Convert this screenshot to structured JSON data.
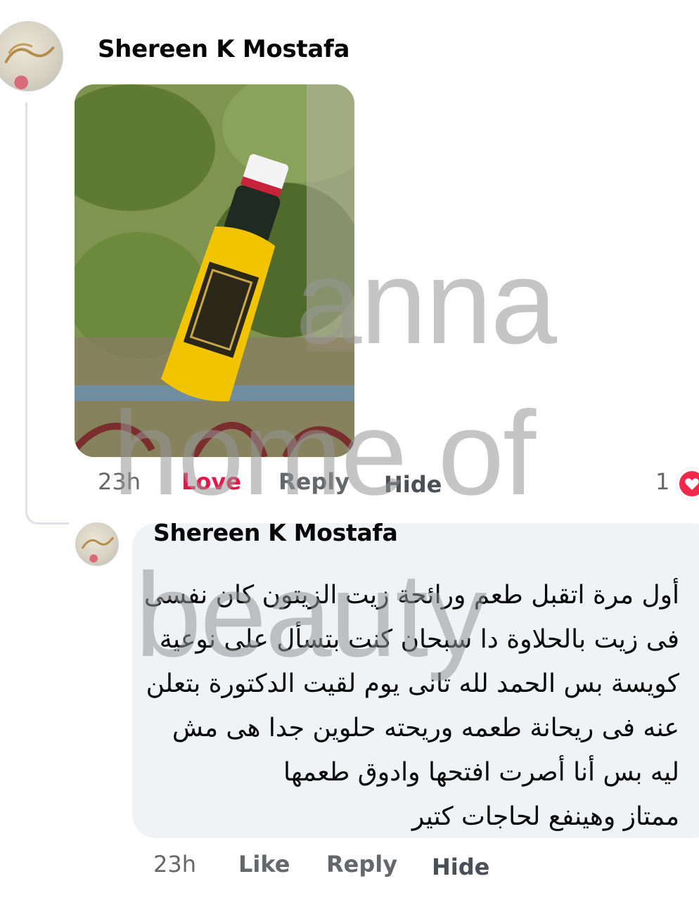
{
  "comment_main": {
    "author": "Shereen K Mostafa",
    "time": "23h",
    "actions": {
      "love": "Love",
      "reply": "Reply",
      "hide": "Hide"
    },
    "reaction_count": "1"
  },
  "comment_reply": {
    "author": "Shereen K Mostafa",
    "text_lines": [
      "أول مرة اتقبل طعم ورائحة زيت الزيتون كان نفسى",
      "فى زيت بالحلاوة دا سبحان كنت بتسأل على نوعية",
      "كويسة بس الحمد لله تانى يوم لقيت الدكتورة بتعلن",
      "عنه فى ريحانة طعمه وريحته حلوين جدا هى مش",
      "ليه بس أنا أصرت افتحها وادوق طعمها",
      "ممتاز وهينفع لحاجات كتير"
    ],
    "time": "23h",
    "actions": {
      "like": "Like",
      "reply": "Reply",
      "hide": "Hide"
    }
  },
  "watermark": {
    "line1": "anna",
    "line2": "home of",
    "line3": "beauty"
  },
  "icons": {
    "reaction": "love-heart-icon"
  },
  "colors": {
    "love": "#e4174b",
    "bubble": "#f0f2f5",
    "meta": "#65676b"
  }
}
